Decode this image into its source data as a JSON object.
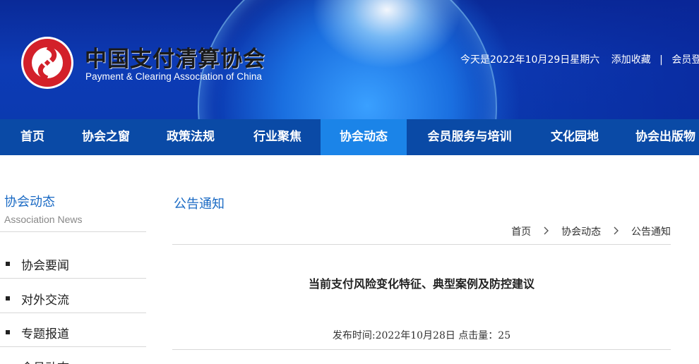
{
  "header": {
    "site_title": "中国支付清算协会",
    "site_subtitle": "Payment & Clearing Association of China",
    "date_text": "今天是2022年10月29日星期六",
    "bookmark_link": "添加收藏",
    "separator": "|",
    "member_login": "会员登录"
  },
  "nav": {
    "items": [
      {
        "label": "首页"
      },
      {
        "label": "协会之窗"
      },
      {
        "label": "政策法规"
      },
      {
        "label": "行业聚焦"
      },
      {
        "label": "协会动态"
      },
      {
        "label": "会员服务与培训"
      },
      {
        "label": "文化园地"
      },
      {
        "label": "协会出版物"
      }
    ],
    "active_index": 4
  },
  "sidebar": {
    "title": "协会动态",
    "subtitle": "Association News",
    "items": [
      {
        "label": "协会要闻"
      },
      {
        "label": "对外交流"
      },
      {
        "label": "专题报道"
      },
      {
        "label": "会员动态"
      }
    ]
  },
  "main": {
    "heading": "公告通知",
    "breadcrumb": [
      "首页",
      "协会动态",
      "公告通知"
    ],
    "article_title": "当前支付风险变化特征、典型案例及防控建议",
    "article_meta": "发布时间:2022年10月28日 点击量：25"
  },
  "colors": {
    "nav_bg": "#0a4aa6",
    "nav_active": "#1b84e8",
    "accent_text": "#1a6ac4",
    "logo_red": "#d3202a"
  }
}
